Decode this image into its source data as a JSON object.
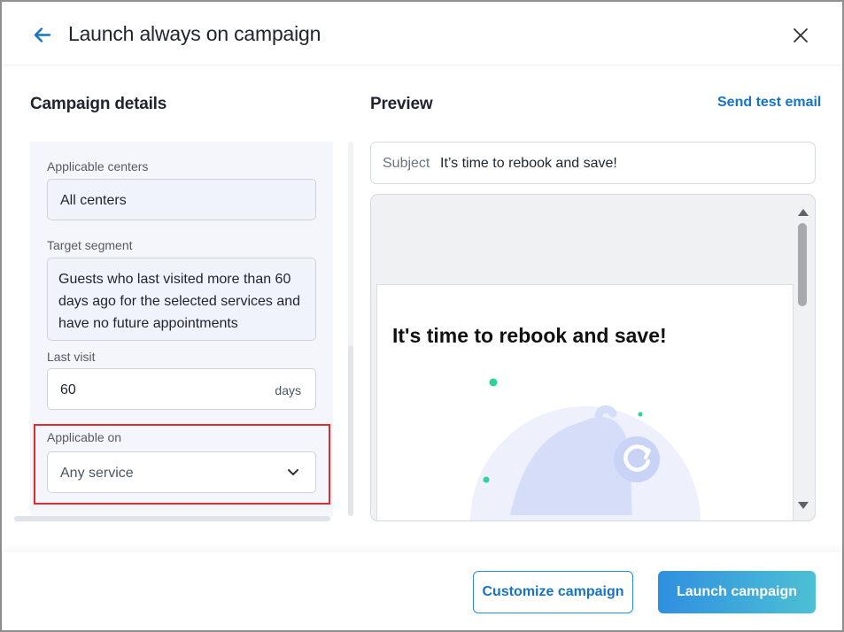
{
  "header": {
    "title": "Launch always on campaign",
    "back_icon": "arrow-left-icon",
    "close_icon": "close-icon",
    "accent_color": "#1574c8"
  },
  "campaign_details": {
    "title": "Campaign details",
    "applicable_centers": {
      "label": "Applicable centers",
      "value": "All centers"
    },
    "target_segment": {
      "label": "Target segment",
      "value": "Guests who last visited more than 60 days ago for the selected services and have no future appointments"
    },
    "last_visit": {
      "label": "Last visit",
      "value": "60",
      "unit": "days"
    },
    "applicable_on": {
      "label": "Applicable on",
      "value": "Any service",
      "icon": "chevron-down-icon",
      "highlight_color": "#e02b2b"
    }
  },
  "preview": {
    "title": "Preview",
    "send_test_label": "Send test email",
    "subject_label": "Subject",
    "subject_value": "It’s time to rebook and save!",
    "email_heading": "It's time to rebook and save!",
    "illustration": "bell-rebook-icon"
  },
  "footer": {
    "customize_label": "Customize campaign",
    "launch_label": "Launch campaign",
    "launch_gradient": [
      "#2f8fe0",
      "#4cc0d4"
    ]
  }
}
